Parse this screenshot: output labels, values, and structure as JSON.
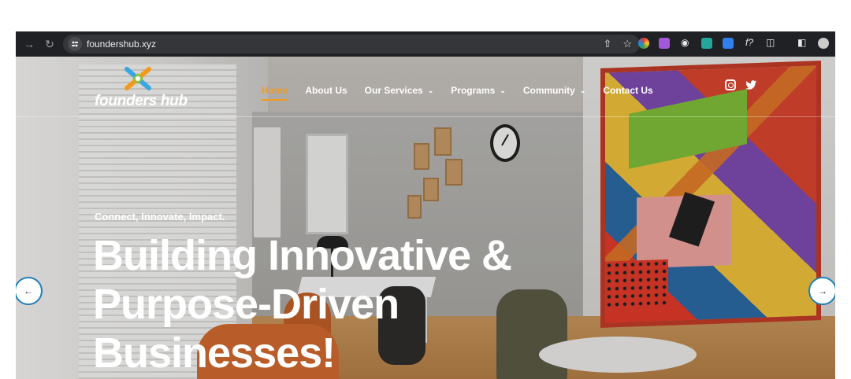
{
  "browser": {
    "url": "foundershub.xyz",
    "icons": [
      "back-arrow-icon",
      "reload-icon",
      "site-settings-icon",
      "share-icon",
      "bookmark-star-icon",
      "extensions-icon",
      "sidebar-icon",
      "profile-avatar-icon"
    ]
  },
  "site": {
    "logo_text": "founders hub",
    "nav": [
      {
        "label": "Home",
        "active": true,
        "dropdown": false
      },
      {
        "label": "About Us",
        "active": false,
        "dropdown": false
      },
      {
        "label": "Our Services",
        "active": false,
        "dropdown": true
      },
      {
        "label": "Programs",
        "active": false,
        "dropdown": true
      },
      {
        "label": "Community",
        "active": false,
        "dropdown": true
      },
      {
        "label": "Contact Us",
        "active": false,
        "dropdown": false
      }
    ],
    "social": [
      "instagram-icon",
      "twitter-icon"
    ],
    "colors": {
      "accent": "#f39a1d",
      "arrow_border": "#1f7fb7"
    }
  },
  "hero": {
    "tagline": "Connect, Innovate, Impact.",
    "headline_lines": [
      "Building Innovative &",
      "Purpose-Driven",
      "Businesses!"
    ]
  }
}
